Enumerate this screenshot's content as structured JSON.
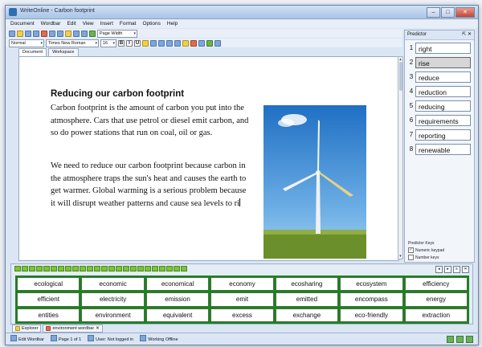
{
  "window": {
    "title": "WriteOnline - Carbon footprint",
    "min": "–",
    "max": "□",
    "close": "✕"
  },
  "menu": [
    "Document",
    "Wordbar",
    "Edit",
    "View",
    "Insert",
    "Format",
    "Options",
    "Help"
  ],
  "toolbar": {
    "zoom": "Page Width",
    "style": "Normal",
    "font": "Times New Roman",
    "size": "16",
    "bold": "B",
    "italic": "I",
    "underline": "U"
  },
  "doc_tabs": [
    "Document",
    "Workspace"
  ],
  "document": {
    "heading": "Reducing our carbon footprint",
    "paragraph1": "Carbon footprint is the amount of carbon you put into the atmosphere.  Cars that use petrol or diesel emit carbon, and so do power stations that run on coal, oil or gas.",
    "paragraph2": "We need to reduce our carbon footprint because carbon in the atmosphere traps the sun's heat and causes the earth to get warmer. Global warming is a serious problem because it will disrupt weather patterns and cause sea levels to ri"
  },
  "predictor": {
    "title": "Predictor",
    "controls": "⇱ ✕",
    "items": [
      {
        "num": "1",
        "word": "right"
      },
      {
        "num": "2",
        "word": "rise"
      },
      {
        "num": "3",
        "word": "reduce"
      },
      {
        "num": "4",
        "word": "reduction"
      },
      {
        "num": "5",
        "word": "reducing"
      },
      {
        "num": "6",
        "word": "requirements"
      },
      {
        "num": "7",
        "word": "reporting"
      },
      {
        "num": "8",
        "word": "renewable"
      }
    ],
    "keys_title": "Predictor Keys",
    "numeric_keypad": "Numeric keypad",
    "number_keys": "Number keys"
  },
  "wordbar": {
    "words": [
      "ecological",
      "economic",
      "economical",
      "economy",
      "ecosharing",
      "ecosystem",
      "efficiency",
      "efficient",
      "electricity",
      "emission",
      "emit",
      "emitted",
      "encompass",
      "energy",
      "entities",
      "environment",
      "equivalent",
      "excess",
      "exchange",
      "eco-friendly",
      "extraction"
    ]
  },
  "bottom_tabs": [
    "Explorer",
    "environment wordbar"
  ],
  "status": {
    "edit": "Edit Wordbar",
    "page": "Page 1 of 1",
    "user": "User: Not logged in",
    "offline": "Working Offline"
  }
}
